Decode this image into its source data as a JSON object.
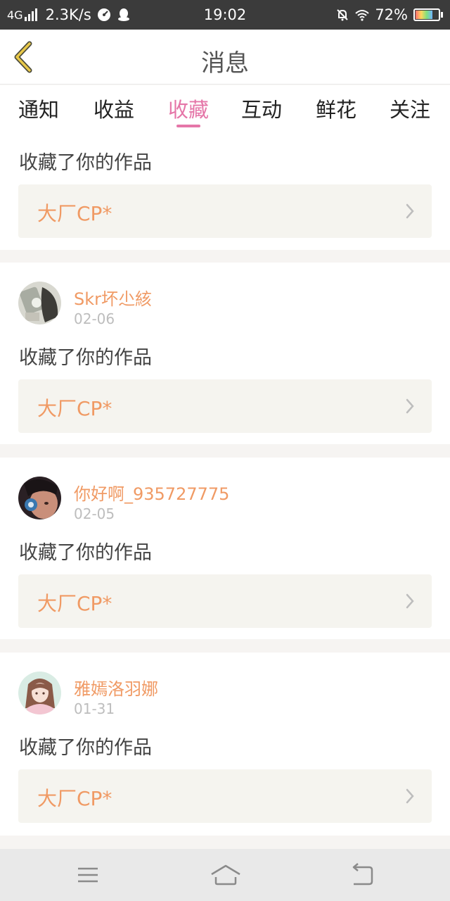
{
  "status_bar": {
    "network": "4G",
    "speed": "2.3K/s",
    "time": "19:02",
    "battery": "72%",
    "battery_level": 0.72
  },
  "header": {
    "title": "消息"
  },
  "tabs": [
    {
      "label": "通知"
    },
    {
      "label": "收益"
    },
    {
      "label": "收藏",
      "active": true
    },
    {
      "label": "互动"
    },
    {
      "label": "鲜花"
    },
    {
      "label": "关注"
    }
  ],
  "feed": [
    {
      "username": "",
      "date": "",
      "action": "收藏了你的作品",
      "work": "大厂CP*"
    },
    {
      "username": "Skr坏尐絯",
      "date": "02-06",
      "action": "收藏了你的作品",
      "work": "大厂CP*",
      "avatar": "avatar-gray-icon"
    },
    {
      "username": "你好啊_935727775",
      "date": "02-05",
      "action": "收藏了你的作品",
      "work": "大厂CP*",
      "avatar": "avatar-child-icon"
    },
    {
      "username": "雅嫣洛羽娜",
      "date": "01-31",
      "action": "收藏了你的作品",
      "work": "大厂CP*",
      "avatar": "avatar-anime-girl-icon"
    }
  ],
  "colors": {
    "accent": "#e576a8",
    "username": "#f09a64",
    "work_box": "#f5f4ef",
    "page_bg": "#f6f4f2"
  }
}
